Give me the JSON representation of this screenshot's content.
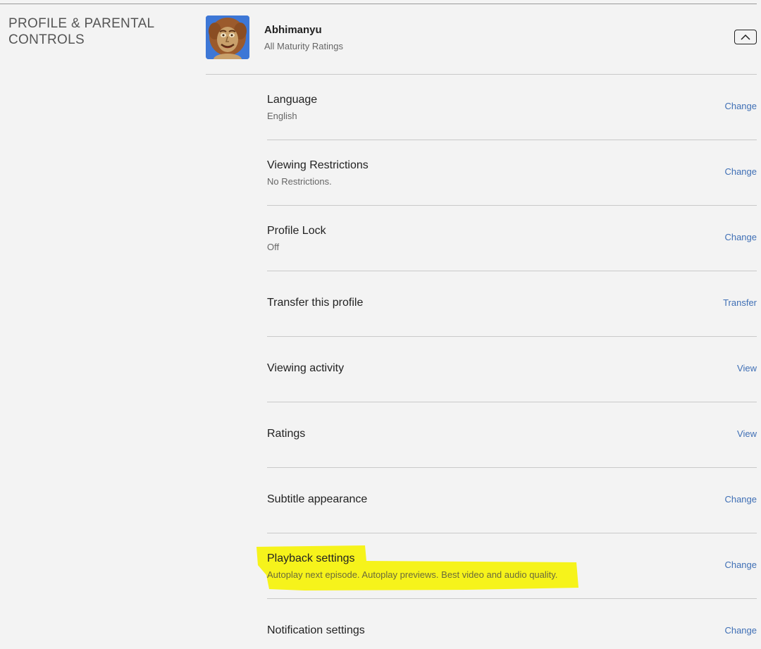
{
  "section": {
    "title_line1": "PROFILE & PARENTAL",
    "title_line2": "CONTROLS"
  },
  "profile": {
    "name": "Abhimanyu",
    "maturity": "All Maturity Ratings",
    "avatar_icon": "cartoon-character-avatar",
    "collapse_icon": "chevron-up-icon"
  },
  "settings": [
    {
      "title": "Language",
      "subtitle": "English",
      "action": "Change"
    },
    {
      "title": "Viewing Restrictions",
      "subtitle": "No Restrictions.",
      "action": "Change"
    },
    {
      "title": "Profile Lock",
      "subtitle": "Off",
      "action": "Change"
    },
    {
      "title": "Transfer this profile",
      "subtitle": "",
      "action": "Transfer"
    },
    {
      "title": "Viewing activity",
      "subtitle": "",
      "action": "View"
    },
    {
      "title": "Ratings",
      "subtitle": "",
      "action": "View"
    },
    {
      "title": "Subtitle appearance",
      "subtitle": "",
      "action": "Change"
    },
    {
      "title": "Playback settings",
      "subtitle": "Autoplay next episode. Autoplay previews. Best video and audio quality.",
      "action": "Change"
    },
    {
      "title": "Notification settings",
      "subtitle": "",
      "action": "Change"
    }
  ],
  "colors": {
    "background": "#f3f3f3",
    "link": "#3f6fb5",
    "highlight": "#f5f20f",
    "avatar_bg": "#3d77d6"
  }
}
